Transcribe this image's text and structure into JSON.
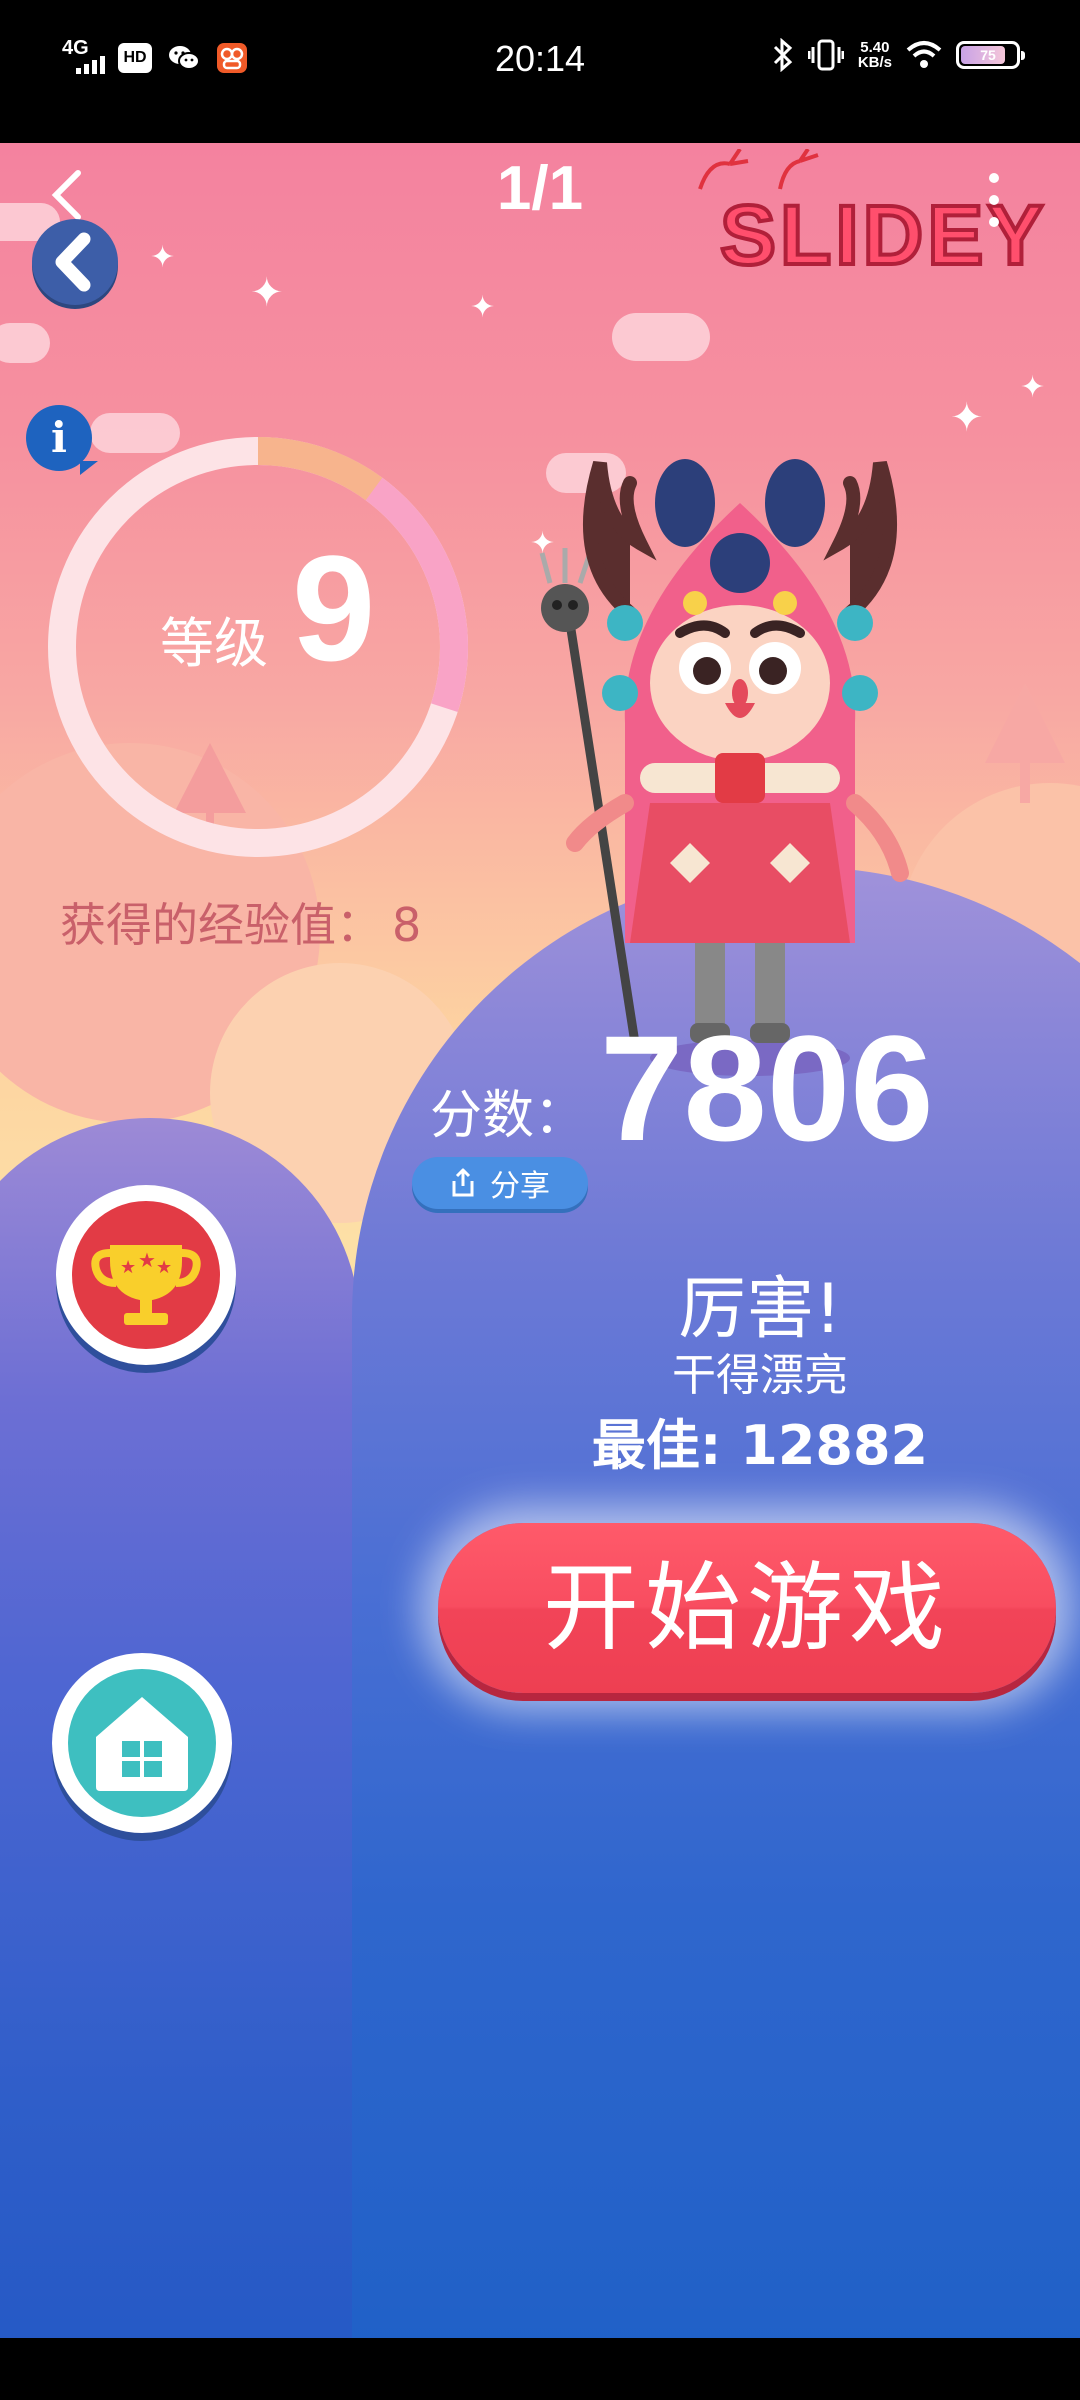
{
  "status_bar": {
    "network": "4G",
    "hd": "HD",
    "time": "20:14",
    "speed_value": "5.40",
    "speed_unit": "KB/s",
    "battery": "75"
  },
  "header": {
    "page_counter": "1/1",
    "logo_text": "SLIDEY"
  },
  "level": {
    "label": "等级",
    "value": "9",
    "progress": 0.3,
    "exp_label": "获得的经验值：",
    "exp_value": "8"
  },
  "score": {
    "label": "分数：",
    "value": "7806",
    "share_label": "分享"
  },
  "result": {
    "praise_title": "厉害!",
    "praise_subtitle": "干得漂亮",
    "best": "最佳: 12882"
  },
  "actions": {
    "start_label": "开始游戏"
  },
  "colors": {
    "accent_start": "#f24458",
    "trophy_bg": "#e23b45",
    "home_bg": "#3ebfc0",
    "exp_text": "#c9606a"
  },
  "icons": {
    "back": "chevron-left-icon",
    "round_back": "back-arrow-icon",
    "info": "info-icon",
    "more": "more-vertical-icon",
    "share": "share-icon",
    "trophy": "trophy-icon",
    "home": "home-icon"
  }
}
